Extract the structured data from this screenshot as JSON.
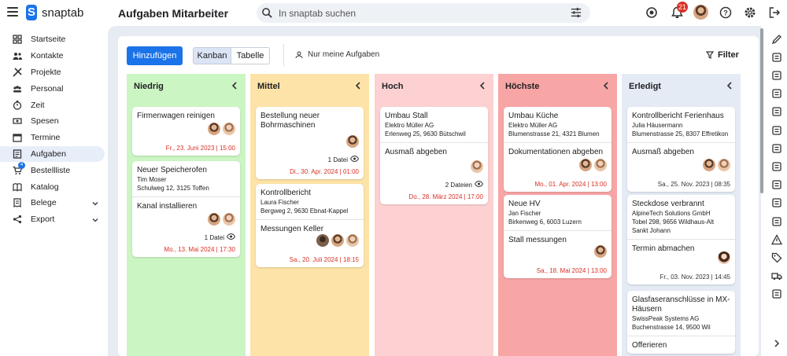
{
  "app": {
    "name": "snaptab",
    "title": "Aufgaben Mitarbeiter",
    "search_placeholder": "In snaptab suchen",
    "notif_count": "21"
  },
  "sidebar": [
    {
      "label": "Startseite",
      "icon": "dashboard-icon"
    },
    {
      "label": "Kontakte",
      "icon": "contacts-icon"
    },
    {
      "label": "Projekte",
      "icon": "tools-icon"
    },
    {
      "label": "Personal",
      "icon": "people-icon"
    },
    {
      "label": "Zeit",
      "icon": "timer-icon"
    },
    {
      "label": "Spesen",
      "icon": "money-icon"
    },
    {
      "label": "Termine",
      "icon": "calendar-icon"
    },
    {
      "label": "Aufgaben",
      "icon": "task-icon"
    },
    {
      "label": "Bestellliste",
      "icon": "cart-icon",
      "badge": "4"
    },
    {
      "label": "Katalog",
      "icon": "book-icon"
    },
    {
      "label": "Belege",
      "icon": "receipt-icon"
    },
    {
      "label": "Export",
      "icon": "share-icon"
    }
  ],
  "toolbar": {
    "add": "Hinzufügen",
    "kanban": "Kanban",
    "table": "Tabelle",
    "mine": "Nur meine Aufgaben",
    "filter": "Filter"
  },
  "columns": [
    {
      "title": "Niedrig",
      "cards": [
        {
          "title": "Firmenwagen reinigen",
          "date": "Fr., 23. Juni 2023 | 15:00"
        },
        {
          "title": "Neuer Speicherofen",
          "sub1": "Tim Moser",
          "sub2": "Schulweg 12, 3125 Toffen",
          "task": "Kanal installieren",
          "files": "1 Datei",
          "date": "Mo., 13. Mai 2024 | 17:30"
        }
      ]
    },
    {
      "title": "Mittel",
      "cards": [
        {
          "title": "Bestellung neuer Bohrmaschinen",
          "files": "1 Datei",
          "date": "Di., 30. Apr. 2024 | 01:00"
        },
        {
          "title": "Kontrollbericht",
          "sub1": "Laura Fischer",
          "sub2": "Bergweg 2, 9630 Ebnat-Kappel",
          "task": "Messungen Keller",
          "date": "Sa., 20. Juli 2024 | 18:15"
        }
      ]
    },
    {
      "title": "Hoch",
      "cards": [
        {
          "title": "Umbau Stall",
          "sub1": "Elektro Müller AG",
          "sub2": "Erlenweg 25, 9630 Bütschwil",
          "task": "Ausmaß abgeben",
          "files": "2 Dateien",
          "date": "Do., 28. März 2024 | 17:00"
        }
      ]
    },
    {
      "title": "Höchste",
      "cards": [
        {
          "title": "Umbau Küche",
          "sub1": "Elektro Müller AG",
          "sub2": "Blumenstrasse 21, 4321 Blumen",
          "task": "Dokumentationen abgeben",
          "date": "Mo., 01. Apr. 2024 | 13:00"
        },
        {
          "title": "Neue HV",
          "sub1": "Jan Fischer",
          "sub2": "Birkenweg 6, 6003 Luzern",
          "task": "Stall messungen",
          "date": "Sa., 18. Mai 2024 | 13:00"
        }
      ]
    },
    {
      "title": "Erledigt",
      "cards": [
        {
          "title": "Kontrollbericht Ferienhaus",
          "sub1": "Julia Häusermann",
          "sub2": "Blumenstrasse 25, 8307 Effretikon",
          "task": "Ausmaß abgeben",
          "date": "Sa., 25. Nov. 2023 | 08:35"
        },
        {
          "title": "Steckdose verbrannt",
          "sub1": "AlpineTech Solutions GmbH",
          "sub2": "Tobel 298, 9656 Wildhaus-Alt Sankt Johann",
          "task": "Termin abmachen",
          "date": "Fr., 03. Nov. 2023 | 14:45"
        },
        {
          "title": "Glasfaseranschlüsse in MX-Häusern",
          "sub1": "SwissPeak Systems AG",
          "sub2": "Buchenstrasse 14, 9500 Wil",
          "task": "Offerieren"
        }
      ]
    }
  ],
  "colors": {
    "niedrig": "#ccf5c4",
    "mittel": "#fde3a7",
    "hoch": "#fdd1d1",
    "hoechste": "#f8a5a5",
    "erledigt": "#e4ebf4",
    "accent": "#1a73e8",
    "due": "#d93025"
  }
}
